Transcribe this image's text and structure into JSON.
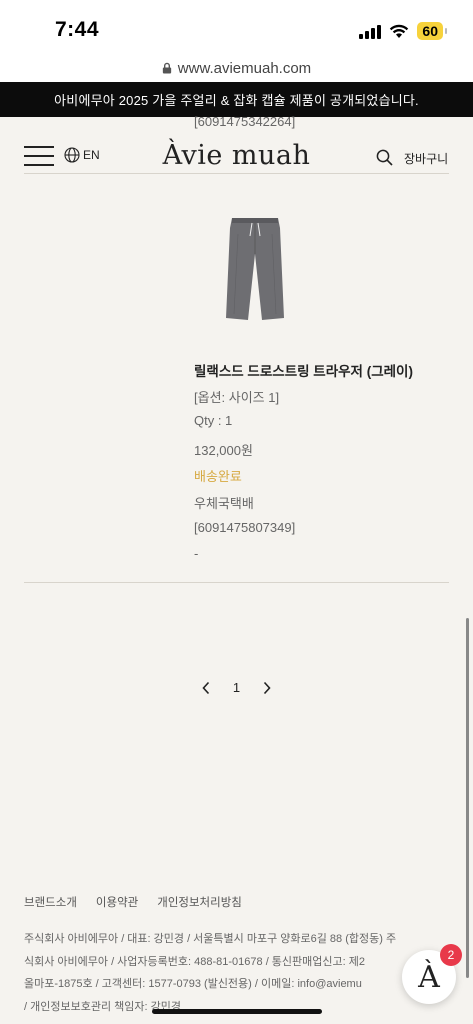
{
  "status_bar": {
    "time": "7:44",
    "battery": "60"
  },
  "browser": {
    "url": "www.aviemuah.com"
  },
  "announcement": "아비에무아 2025 가을 주얼리 & 잡화 캡슐 제품이 공개되었습니다.",
  "header": {
    "language": "EN",
    "logo": "Àvie muah",
    "cart_label": "장바구니",
    "peek_tracking": "[6091475342264]"
  },
  "order_item": {
    "name": "릴랙스드 드로스트링 트라우저 (그레이)",
    "option": "[옵션: 사이즈 1]",
    "qty": "Qty : 1",
    "price": "132,000원",
    "status": "배송완료",
    "carrier": "우체국택배",
    "tracking": "[6091475807349]",
    "extra": "-"
  },
  "pagination": {
    "current": "1"
  },
  "footer": {
    "links": [
      "브랜드소개",
      "이용약관",
      "개인정보처리방침"
    ],
    "company_lines": [
      "주식회사 아비에무아 / 대표: 강민경 / 서울특별시 마포구 양화로6길 88 (합정동) 주",
      "식회사 아비에무아 / 사업자등록번호: 488-81-01678 / 통신판매업신고: 제2",
      "올마포-1875호 / 고객센터: 1577-0793 (발신전용) / 이메일: info@aviemu",
      "/ 개인정보보호관리 책임자: 강민경"
    ]
  },
  "chat": {
    "logo": "À",
    "badge": "2"
  },
  "colors": {
    "status_shipped": "#d6a942",
    "banner_bg": "#0c0c0c",
    "page_bg": "#f5f3ef",
    "badge": "#e8394a"
  }
}
